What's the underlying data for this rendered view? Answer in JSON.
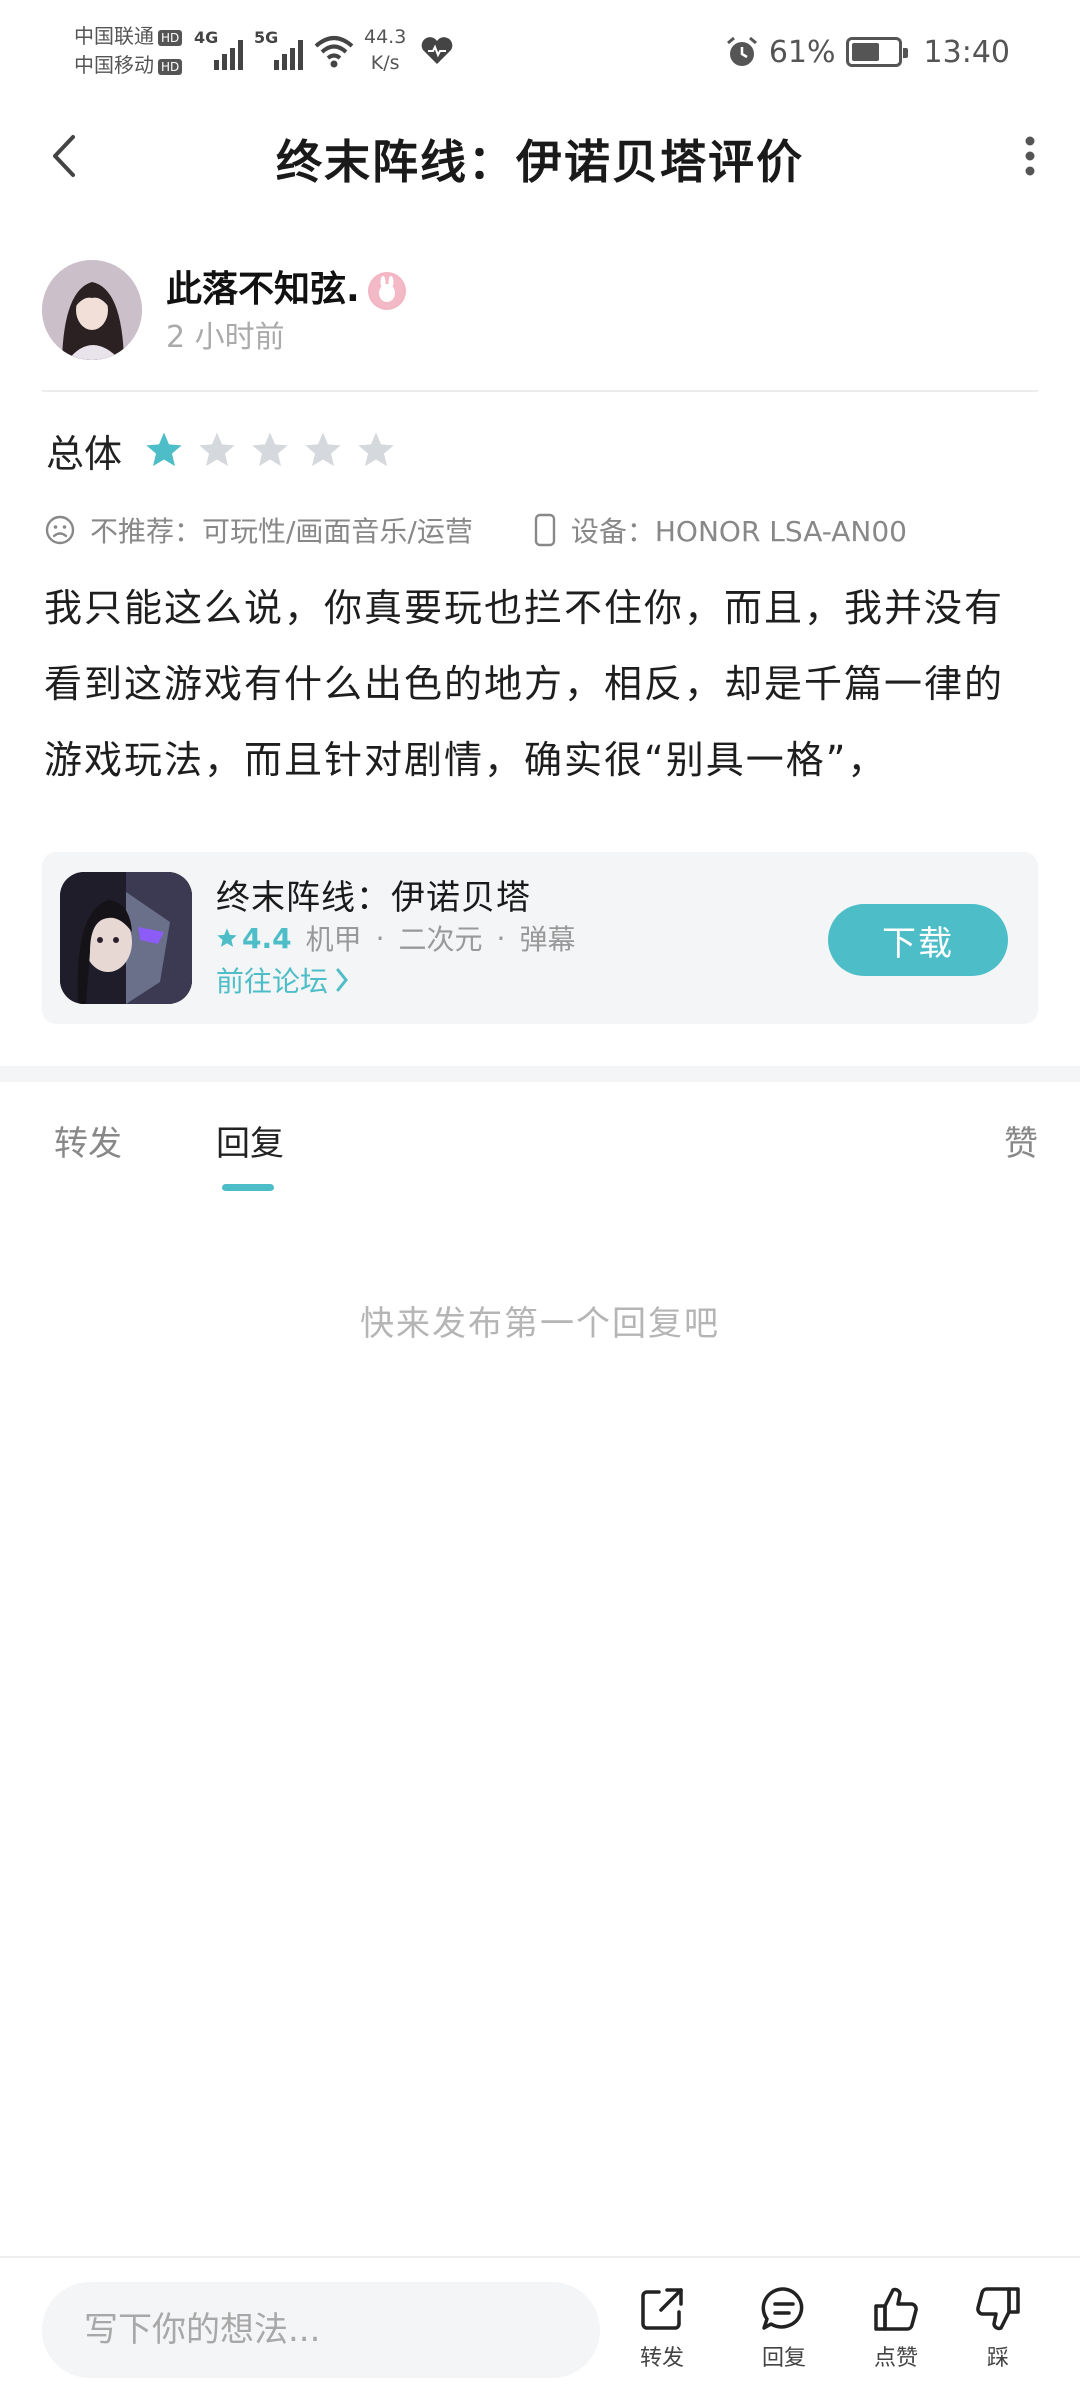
{
  "status_bar": {
    "carrier1": "中国联通",
    "carrier2": "中国移动",
    "hd": "HD",
    "net1": "4G",
    "net2": "5G",
    "speed_value": "44.3",
    "speed_unit": "K/s",
    "battery_percent": "61%",
    "battery_level": 0.61,
    "time": "13:40"
  },
  "header": {
    "title": "终末阵线：伊诺贝塔评价"
  },
  "author": {
    "name": "此落不知弦.",
    "time": "2 小时前"
  },
  "rating": {
    "label": "总体",
    "value": 1,
    "max": 5,
    "accent": "#4dbec8",
    "empty": "#d5d8dc"
  },
  "meta": {
    "recommend": "不推荐：可玩性/画面音乐/运营",
    "device": "设备：HONOR LSA-AN00"
  },
  "review": {
    "text": "我只能这么说，你真要玩也拦不住你，而且，我并没有看到这游戏有什么出色的地方，相反，却是千篇一律的游戏玩法，而且针对剧情，确实很“别具一格”，"
  },
  "game": {
    "name": "终末阵线：伊诺贝塔",
    "score": "4.4",
    "tag1": "机甲",
    "tag2": "二次元",
    "tag3": "弹幕",
    "dot": "·",
    "forum": "前往论坛",
    "download": "下载"
  },
  "tabs": {
    "repost": "转发",
    "reply": "回复",
    "like": "赞"
  },
  "empty_text": "快来发布第一个回复吧",
  "bottom": {
    "placeholder": "写下你的想法...",
    "repost": "转发",
    "reply": "回复",
    "like": "点赞",
    "dislike": "踩"
  }
}
